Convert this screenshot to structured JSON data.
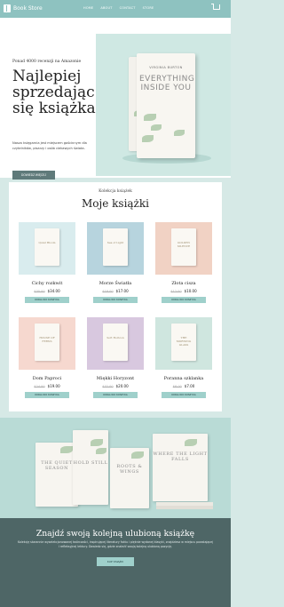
{
  "header": {
    "logo_text": "Book Store",
    "nav": [
      "HOME",
      "ABOUT",
      "CONTACT",
      "STORE"
    ],
    "cart_icon": "cart-icon"
  },
  "hero": {
    "pre_title": "Ponad 4000 recenzji na Amazonie",
    "title": "Najlepiej sprzedając się książka",
    "description": "Nasza księgarnia jest miejscem gościnnym dla czytelników, pisarzy i osób ciekawych świata.",
    "button": "DOWIEDZ WIĘCEJ",
    "image_books": {
      "author": "VIRGINIA BURTON",
      "title": "EVERYTHING INSIDE YOU"
    }
  },
  "collection": {
    "pre_title": "Kolekcja książek",
    "title": "Moje książki",
    "items": [
      {
        "name": "Cichy rozkwit",
        "old_price": "$35.00",
        "price": "$34.00",
        "button": "DODAJ DO KOSZYKA",
        "cover": "Quiet Bloom",
        "bg": "#d9ecee"
      },
      {
        "name": "Morze Światła",
        "old_price": "$18.00",
        "price": "$17.00",
        "button": "DODAJ DO KOSZYKA",
        "cover": "Sea of Light",
        "bg": "#b7d4de"
      },
      {
        "name": "Złota cisza",
        "old_price": "$12.00",
        "price": "$10.00",
        "button": "DODAJ DO KOSZYKA",
        "cover": "GOLDEN SILENCE",
        "bg": "#f1d2c4"
      },
      {
        "name": "Dom Paproci",
        "old_price": "$24.00",
        "price": "$19.00",
        "button": "DODAJ DO KOSZYKA",
        "cover": "HOUSE OF FERNS",
        "bg": "#f6d8cf"
      },
      {
        "name": "Miękki Horyzont",
        "old_price": "$32.00",
        "price": "$20.00",
        "button": "DODAJ DO KOSZYKA",
        "cover": "Soft Horizon",
        "bg": "#d8c8df"
      },
      {
        "name": "Poranna szklanka",
        "old_price": "$8.00",
        "price": "$7.00",
        "button": "DODAJ DO KOSZYKA",
        "cover": "THE MORNING GLASS",
        "bg": "#cfe6df"
      }
    ]
  },
  "banner": {
    "books": [
      "THE QUIET SEASON",
      "HOLD STILL",
      "ROOTS & WINGS",
      "WHERE THE LIGHT FALLS"
    ]
  },
  "cta": {
    "title": "Znajdź swoją kolejną ulubioną książkę",
    "description": "Kolekcję starannie wyselekcjonowanej twórczości, inspirującej literatury faktu i pięknie wydanej klasyki, znajdziesz w miejscu powstającej i refleksyjnej lektury. Dowiedz się, gdzie znaleźć swoją kolejną ulubioną pozycję.",
    "button": "KUP KSIĄŻKI"
  }
}
